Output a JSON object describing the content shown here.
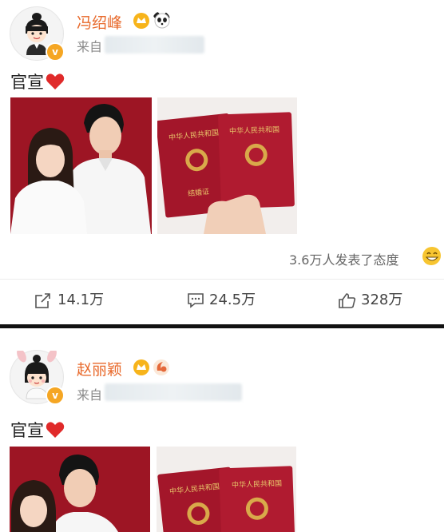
{
  "post1": {
    "username": "冯绍峰",
    "source_prefix": "来自",
    "text": "官宣",
    "reaction_summary": "3.6万人发表了态度",
    "actions": {
      "share": "14.1万",
      "comment": "24.5万",
      "like": "328万"
    },
    "certificate_title": "中华人民共和国",
    "certificate_caption": "结婚证"
  },
  "post2": {
    "username": "赵丽颖",
    "source_prefix": "来自",
    "text": "官宣",
    "certificate_title": "中华人民共和国"
  },
  "colors": {
    "username": "#e8692b",
    "verified_badge": "#f5a623",
    "photo_background": "#9e1625",
    "certificate_red": "#a3162a",
    "heart": "#e02a2a",
    "divider": "#111111"
  },
  "icons": [
    "share-icon",
    "comment-icon",
    "like-icon",
    "heart-icon",
    "panda-icon",
    "grin-emoji-icon"
  ]
}
